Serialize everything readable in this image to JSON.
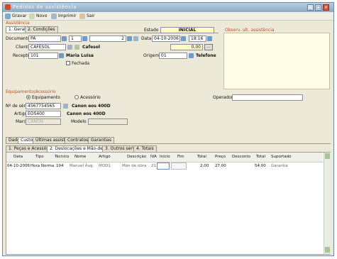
{
  "window": {
    "title": "Pedidos de assistência"
  },
  "toolbar": {
    "save": "Gravar",
    "new": "Novo",
    "print": "Imprimir",
    "exit": "Sair"
  },
  "assist": {
    "section": "Assistência",
    "tabs": [
      "1. Geral",
      "2. Condições"
    ],
    "estado_label": "Estado",
    "estado_value": "INICIAL",
    "documento_label": "Documento",
    "doc_series": "PA",
    "doc_num1": "1",
    "doc_num2": "2",
    "data_label": "Data",
    "data_value": "04-10-2006",
    "hora_value": "18:16",
    "cliente_label": "Cliente",
    "cliente_value": "CAFESOL",
    "cliente_name": "Cafesol",
    "valor": "0,00",
    "receptor_label": "Receptor",
    "receptor_value": "101",
    "receptor_name": "Maria Luísa",
    "origem_label": "Origem",
    "origem_value": "01",
    "origem_name": "Telefone",
    "fechada_label": "Fechada"
  },
  "obs": {
    "title": "Observ. ult. assistência"
  },
  "equip": {
    "section": "Equipamento/Acessório",
    "radio_equip": "Equipamento",
    "radio_acess": "Acessório",
    "operador_label": "Operador",
    "serie_label": "Nº de série",
    "serie_value": "4567754565",
    "serie_desc": "Canon eos 400D",
    "artigo_label": "Artigo",
    "artigo_value": "EOS400",
    "artigo_desc": "Canon eos 400D",
    "marca_label": "Marca",
    "marca_value": "CANON",
    "modelo_label": "Modelo"
  },
  "lower_tabs": [
    "Dados",
    "Custos",
    "Últimas assist.",
    "Contratos",
    "Garantias"
  ],
  "sub_tabs": [
    "1. Peças e Acessórios",
    "2. Deslocações e Mão-de-obra",
    "3. Outros serviços",
    "4. Totais"
  ],
  "grid": {
    "headers": [
      "Data",
      "Tipo",
      "Técnico",
      "Nome",
      "Artigo",
      "Descrição",
      "IVA",
      "Início",
      "Fim",
      "Total",
      "Preço",
      "Desconto",
      "Total",
      "Suportado"
    ],
    "row": [
      "04-10-2006",
      "Hora Norma",
      "104",
      "Manuel Aug.",
      "MOD1",
      "Mão de obra",
      "21",
      "",
      "",
      "2,00",
      "27,00",
      "",
      "54,00",
      "Garantia"
    ]
  }
}
